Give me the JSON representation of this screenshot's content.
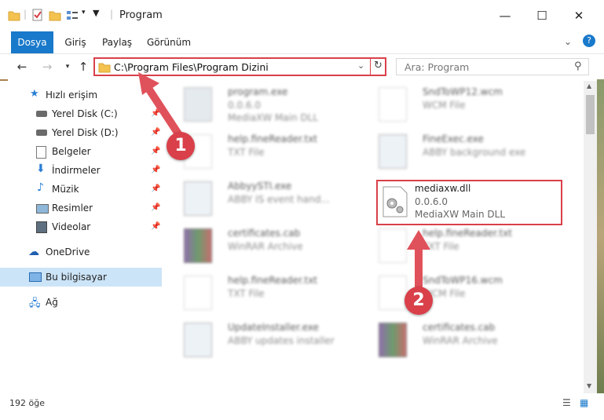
{
  "window": {
    "title": "Program"
  },
  "ribbon": {
    "tabs": [
      "Dosya",
      "Giriş",
      "Paylaş",
      "Görünüm"
    ]
  },
  "nav": {
    "address": "C:\\Program Files\\Program Dizini",
    "search_placeholder": "Ara: Program"
  },
  "sidebar": {
    "quick_access": "Hızlı erişim",
    "items": [
      {
        "label": "Yerel Disk (C:)",
        "icon": "drive-icon",
        "pinned": true
      },
      {
        "label": "Yerel Disk (D:)",
        "icon": "drive-icon",
        "pinned": true
      },
      {
        "label": "Belgeler",
        "icon": "documents-icon",
        "pinned": true
      },
      {
        "label": "İndirmeler",
        "icon": "downloads-icon",
        "pinned": true
      },
      {
        "label": "Müzik",
        "icon": "music-icon",
        "pinned": true
      },
      {
        "label": "Resimler",
        "icon": "pictures-icon",
        "pinned": true
      },
      {
        "label": "Videolar",
        "icon": "videos-icon",
        "pinned": true
      }
    ],
    "onedrive": "OneDrive",
    "this_pc": "Bu bilgisayar",
    "network": "Ağ"
  },
  "files": [
    {
      "name": "program.exe",
      "line1": "0.0.6.0",
      "line2": "MediaXW Main DLL"
    },
    {
      "name": "SndToWP12.wcm",
      "line1": "WCM File",
      "line2": ""
    },
    {
      "name": "help.fineReader.txt",
      "line1": "TXT File",
      "line2": ""
    },
    {
      "name": "FineExec.exe",
      "line1": "ABBY background exe",
      "line2": ""
    },
    {
      "name": "AbbyySTI.exe",
      "line1": "ABBY IS event hand...",
      "line2": ""
    },
    {
      "name": "mediaxw.dll",
      "line1": "0.0.6.0",
      "line2": "MediaXW Main DLL"
    },
    {
      "name": "certificates.cab",
      "line1": "WinRAR Archive",
      "line2": ""
    },
    {
      "name": "help.fineReader.txt",
      "line1": "TXT File",
      "line2": ""
    },
    {
      "name": "help.fineReader.txt",
      "line1": "TXT File",
      "line2": ""
    },
    {
      "name": "SndToWP16.wcm",
      "line1": "WCM File",
      "line2": ""
    },
    {
      "name": "UpdateInstaller.exe",
      "line1": "ABBY updates installer",
      "line2": ""
    },
    {
      "name": "certificates.cab",
      "line1": "WinRAR Archive",
      "line2": ""
    }
  ],
  "annotations": {
    "badge1": "1",
    "badge2": "2"
  },
  "status": {
    "count": "192 öğe"
  },
  "colors": {
    "accent": "#1979ca",
    "highlight": "#d9404a",
    "selected": "#cce4f7"
  }
}
